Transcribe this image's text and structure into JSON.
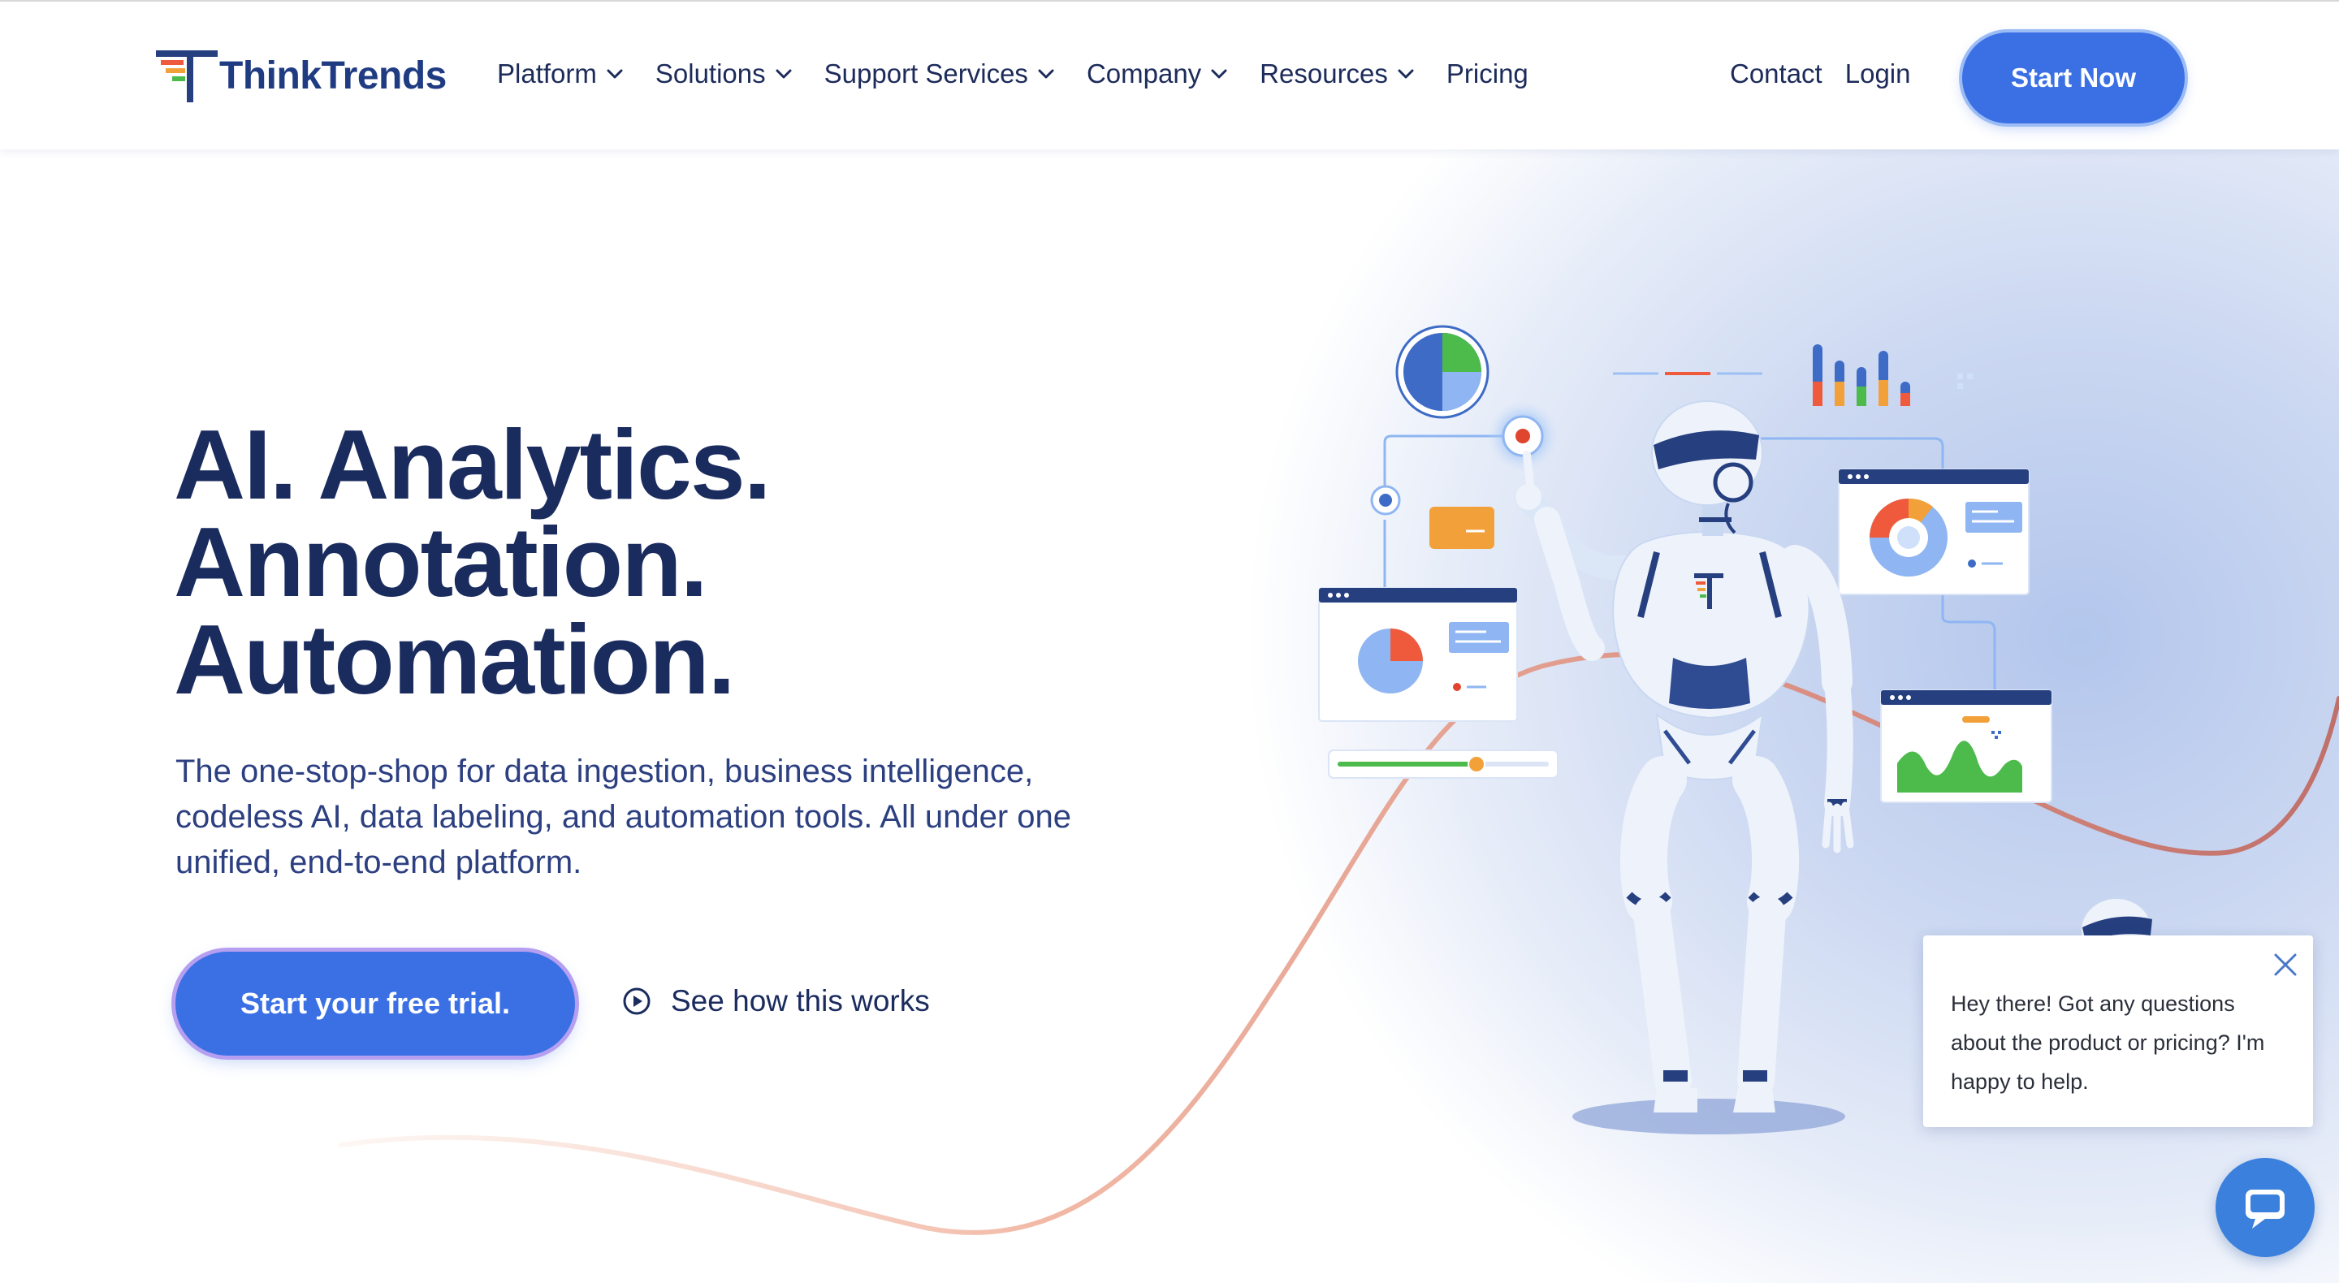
{
  "brand": {
    "name": "ThinkTrends"
  },
  "nav": {
    "items": [
      {
        "label": "Platform",
        "has_dropdown": true
      },
      {
        "label": "Solutions",
        "has_dropdown": true
      },
      {
        "label": "Support Services",
        "has_dropdown": true
      },
      {
        "label": "Company",
        "has_dropdown": true
      },
      {
        "label": "Resources",
        "has_dropdown": true
      },
      {
        "label": "Pricing",
        "has_dropdown": false
      }
    ],
    "contact_label": "Contact",
    "login_label": "Login",
    "start_label": "Start Now"
  },
  "hero": {
    "headline": [
      "AI. Analytics.",
      "Annotation.",
      "Automation."
    ],
    "subtext": "The one-stop-shop for data ingestion, business intelligence, codeless AI, data labeling, and automation tools. All under one unified, end-to-end platform.",
    "cta_label": "Start your free trial.",
    "secondary_label": "See how this works",
    "secondary_icon": "play-circle-icon"
  },
  "chat": {
    "message": "Hey there! Got any questions about the product or pricing? I'm happy to help.",
    "close_icon": "close-icon",
    "launcher_icon": "chat-bubble-icon"
  },
  "colors": {
    "primary": "#3b70e5",
    "navy": "#1a2b5e",
    "accent_red": "#ef5a3c",
    "accent_green": "#4cbb4b",
    "accent_orange": "#f2a13a",
    "light_blue": "#8fb6f2"
  }
}
